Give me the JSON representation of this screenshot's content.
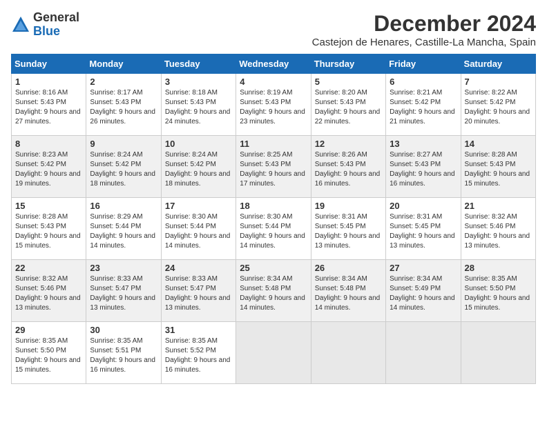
{
  "logo": {
    "general": "General",
    "blue": "Blue"
  },
  "title": {
    "month": "December 2024",
    "location": "Castejon de Henares, Castille-La Mancha, Spain"
  },
  "headers": [
    "Sunday",
    "Monday",
    "Tuesday",
    "Wednesday",
    "Thursday",
    "Friday",
    "Saturday"
  ],
  "weeks": [
    [
      {
        "day": "1",
        "sunrise": "Sunrise: 8:16 AM",
        "sunset": "Sunset: 5:43 PM",
        "daylight": "Daylight: 9 hours and 27 minutes."
      },
      {
        "day": "2",
        "sunrise": "Sunrise: 8:17 AM",
        "sunset": "Sunset: 5:43 PM",
        "daylight": "Daylight: 9 hours and 26 minutes."
      },
      {
        "day": "3",
        "sunrise": "Sunrise: 8:18 AM",
        "sunset": "Sunset: 5:43 PM",
        "daylight": "Daylight: 9 hours and 24 minutes."
      },
      {
        "day": "4",
        "sunrise": "Sunrise: 8:19 AM",
        "sunset": "Sunset: 5:43 PM",
        "daylight": "Daylight: 9 hours and 23 minutes."
      },
      {
        "day": "5",
        "sunrise": "Sunrise: 8:20 AM",
        "sunset": "Sunset: 5:43 PM",
        "daylight": "Daylight: 9 hours and 22 minutes."
      },
      {
        "day": "6",
        "sunrise": "Sunrise: 8:21 AM",
        "sunset": "Sunset: 5:42 PM",
        "daylight": "Daylight: 9 hours and 21 minutes."
      },
      {
        "day": "7",
        "sunrise": "Sunrise: 8:22 AM",
        "sunset": "Sunset: 5:42 PM",
        "daylight": "Daylight: 9 hours and 20 minutes."
      }
    ],
    [
      {
        "day": "8",
        "sunrise": "Sunrise: 8:23 AM",
        "sunset": "Sunset: 5:42 PM",
        "daylight": "Daylight: 9 hours and 19 minutes."
      },
      {
        "day": "9",
        "sunrise": "Sunrise: 8:24 AM",
        "sunset": "Sunset: 5:42 PM",
        "daylight": "Daylight: 9 hours and 18 minutes."
      },
      {
        "day": "10",
        "sunrise": "Sunrise: 8:24 AM",
        "sunset": "Sunset: 5:42 PM",
        "daylight": "Daylight: 9 hours and 18 minutes."
      },
      {
        "day": "11",
        "sunrise": "Sunrise: 8:25 AM",
        "sunset": "Sunset: 5:43 PM",
        "daylight": "Daylight: 9 hours and 17 minutes."
      },
      {
        "day": "12",
        "sunrise": "Sunrise: 8:26 AM",
        "sunset": "Sunset: 5:43 PM",
        "daylight": "Daylight: 9 hours and 16 minutes."
      },
      {
        "day": "13",
        "sunrise": "Sunrise: 8:27 AM",
        "sunset": "Sunset: 5:43 PM",
        "daylight": "Daylight: 9 hours and 16 minutes."
      },
      {
        "day": "14",
        "sunrise": "Sunrise: 8:28 AM",
        "sunset": "Sunset: 5:43 PM",
        "daylight": "Daylight: 9 hours and 15 minutes."
      }
    ],
    [
      {
        "day": "15",
        "sunrise": "Sunrise: 8:28 AM",
        "sunset": "Sunset: 5:43 PM",
        "daylight": "Daylight: 9 hours and 15 minutes."
      },
      {
        "day": "16",
        "sunrise": "Sunrise: 8:29 AM",
        "sunset": "Sunset: 5:44 PM",
        "daylight": "Daylight: 9 hours and 14 minutes."
      },
      {
        "day": "17",
        "sunrise": "Sunrise: 8:30 AM",
        "sunset": "Sunset: 5:44 PM",
        "daylight": "Daylight: 9 hours and 14 minutes."
      },
      {
        "day": "18",
        "sunrise": "Sunrise: 8:30 AM",
        "sunset": "Sunset: 5:44 PM",
        "daylight": "Daylight: 9 hours and 14 minutes."
      },
      {
        "day": "19",
        "sunrise": "Sunrise: 8:31 AM",
        "sunset": "Sunset: 5:45 PM",
        "daylight": "Daylight: 9 hours and 13 minutes."
      },
      {
        "day": "20",
        "sunrise": "Sunrise: 8:31 AM",
        "sunset": "Sunset: 5:45 PM",
        "daylight": "Daylight: 9 hours and 13 minutes."
      },
      {
        "day": "21",
        "sunrise": "Sunrise: 8:32 AM",
        "sunset": "Sunset: 5:46 PM",
        "daylight": "Daylight: 9 hours and 13 minutes."
      }
    ],
    [
      {
        "day": "22",
        "sunrise": "Sunrise: 8:32 AM",
        "sunset": "Sunset: 5:46 PM",
        "daylight": "Daylight: 9 hours and 13 minutes."
      },
      {
        "day": "23",
        "sunrise": "Sunrise: 8:33 AM",
        "sunset": "Sunset: 5:47 PM",
        "daylight": "Daylight: 9 hours and 13 minutes."
      },
      {
        "day": "24",
        "sunrise": "Sunrise: 8:33 AM",
        "sunset": "Sunset: 5:47 PM",
        "daylight": "Daylight: 9 hours and 13 minutes."
      },
      {
        "day": "25",
        "sunrise": "Sunrise: 8:34 AM",
        "sunset": "Sunset: 5:48 PM",
        "daylight": "Daylight: 9 hours and 14 minutes."
      },
      {
        "day": "26",
        "sunrise": "Sunrise: 8:34 AM",
        "sunset": "Sunset: 5:48 PM",
        "daylight": "Daylight: 9 hours and 14 minutes."
      },
      {
        "day": "27",
        "sunrise": "Sunrise: 8:34 AM",
        "sunset": "Sunset: 5:49 PM",
        "daylight": "Daylight: 9 hours and 14 minutes."
      },
      {
        "day": "28",
        "sunrise": "Sunrise: 8:35 AM",
        "sunset": "Sunset: 5:50 PM",
        "daylight": "Daylight: 9 hours and 15 minutes."
      }
    ],
    [
      {
        "day": "29",
        "sunrise": "Sunrise: 8:35 AM",
        "sunset": "Sunset: 5:50 PM",
        "daylight": "Daylight: 9 hours and 15 minutes."
      },
      {
        "day": "30",
        "sunrise": "Sunrise: 8:35 AM",
        "sunset": "Sunset: 5:51 PM",
        "daylight": "Daylight: 9 hours and 16 minutes."
      },
      {
        "day": "31",
        "sunrise": "Sunrise: 8:35 AM",
        "sunset": "Sunset: 5:52 PM",
        "daylight": "Daylight: 9 hours and 16 minutes."
      },
      null,
      null,
      null,
      null
    ]
  ]
}
